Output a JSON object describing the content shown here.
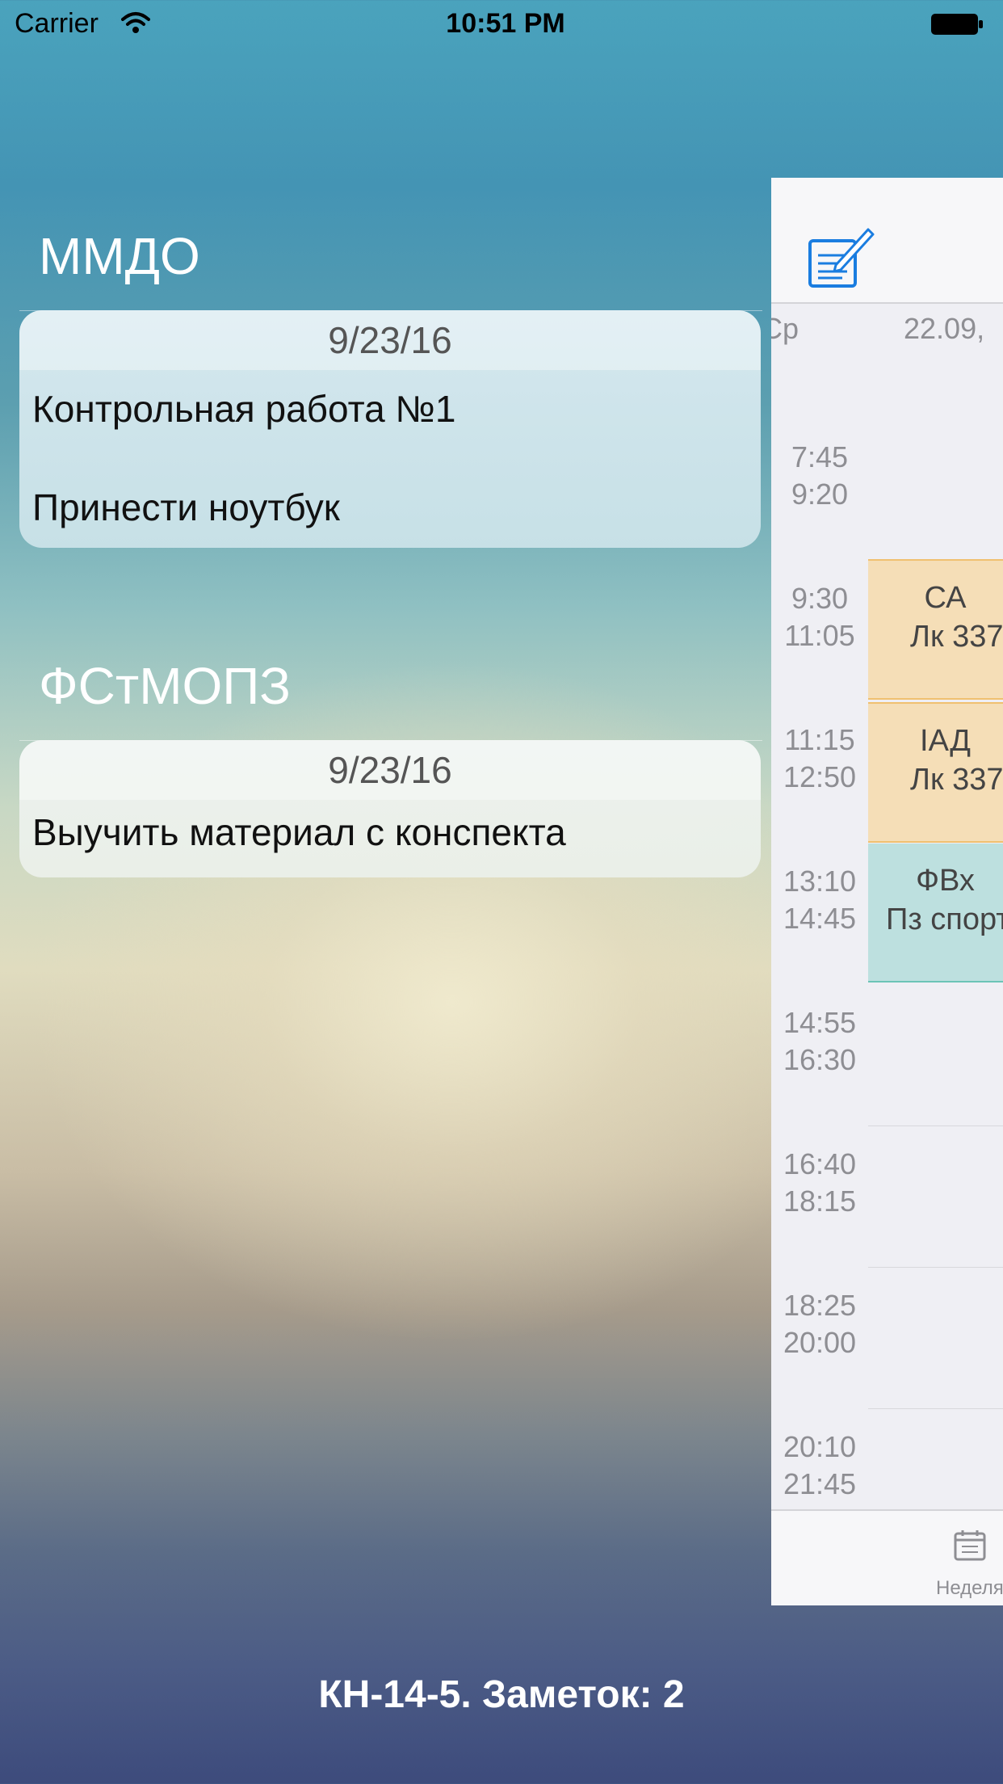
{
  "status_bar": {
    "carrier": "Carrier",
    "time": "10:51 PM"
  },
  "notes": [
    {
      "subject": "ММДО",
      "date": "9/23/16",
      "lines": [
        "Контрольная работа №1",
        "Принести ноутбук"
      ]
    },
    {
      "subject": "ФСтМОПЗ",
      "date": "9/23/16",
      "lines": [
        "Выучить материал с конспекта"
      ]
    }
  ],
  "footer": {
    "text": "КН-14-5. Заметок: 2"
  },
  "schedule": {
    "day_name": "Ср",
    "day_date": "22.09,",
    "slots": [
      {
        "start": "7:45",
        "end": "9:20"
      },
      {
        "start": "9:30",
        "end": "11:05",
        "lesson": {
          "title": "СА",
          "detail": "Лк 337"
        }
      },
      {
        "start": "11:15",
        "end": "12:50",
        "lesson": {
          "title": "ІАД",
          "detail": "Лк 337"
        }
      },
      {
        "start": "13:10",
        "end": "14:45",
        "lesson": {
          "title": "ФВх",
          "detail": "Пз спорт"
        }
      },
      {
        "start": "14:55",
        "end": "16:30"
      },
      {
        "start": "16:40",
        "end": "18:15"
      },
      {
        "start": "18:25",
        "end": "20:00"
      },
      {
        "start": "20:10",
        "end": "21:45"
      }
    ],
    "tab_label": "Неделя"
  },
  "colors": {
    "lesson_orange": "#f5deb7",
    "lesson_teal": "#bde0df",
    "accent_blue": "#1a7de0"
  }
}
